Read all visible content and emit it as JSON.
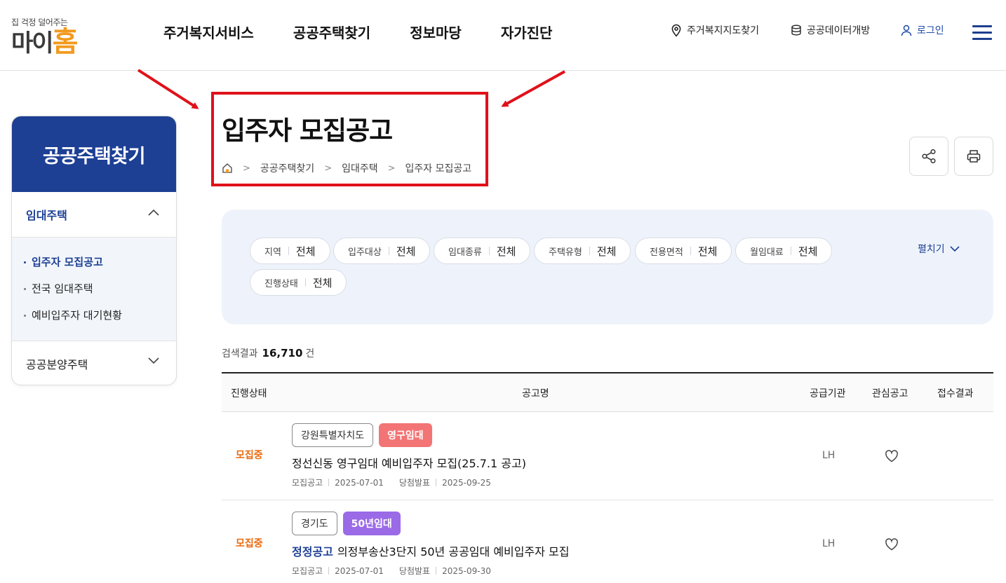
{
  "header": {
    "logo_tagline": "집 걱정 덜어주는",
    "logo_main_a": "마이",
    "logo_main_b": "홈",
    "gnb": [
      "주거복지서비스",
      "공공주택찾기",
      "정보마당",
      "자가진단"
    ],
    "util_map": "주거복지지도찾기",
    "util_data": "공공데이터개방",
    "util_login": "로그인"
  },
  "sidebar": {
    "title": "공공주택찾기",
    "group1": "임대주택",
    "sub_items": [
      "입주자 모집공고",
      "전국 임대주택",
      "예비입주자 대기현황"
    ],
    "group2": "공공분양주택"
  },
  "page": {
    "title": "입주자 모집공고",
    "breadcrumb": [
      "공공주택찾기",
      "임대주택",
      "입주자 모집공고"
    ]
  },
  "filters": {
    "chips": [
      {
        "key": "지역",
        "value": "전체"
      },
      {
        "key": "입주대상",
        "value": "전체"
      },
      {
        "key": "임대종류",
        "value": "전체"
      },
      {
        "key": "주택유형",
        "value": "전체"
      },
      {
        "key": "전용면적",
        "value": "전체"
      },
      {
        "key": "월임대료",
        "value": "전체"
      },
      {
        "key": "진행상태",
        "value": "전체"
      }
    ],
    "expand_label": "펼치기"
  },
  "result": {
    "label": "검색결과",
    "count": "16,710",
    "unit": "건"
  },
  "table": {
    "headers": [
      "진행상태",
      "공고명",
      "공급기관",
      "관심공고",
      "접수결과"
    ],
    "rows": [
      {
        "status": "모집중",
        "region": "강원특별자치도",
        "type": "영구임대",
        "type_color": "#f27474",
        "prefix": "",
        "title": "정선신동 영구임대 예비입주자 모집(25.7.1 공고)",
        "post_label": "모집공고",
        "post_date": "2025-07-01",
        "result_label": "당첨발표",
        "result_date": "2025-09-25",
        "agency": "LH"
      },
      {
        "status": "모집중",
        "region": "경기도",
        "type": "50년임대",
        "type_color": "#9b6ae6",
        "prefix": "정정공고",
        "title": "의정부송산3단지 50년 공공임대 예비입주자 모집",
        "post_label": "모집공고",
        "post_date": "2025-07-01",
        "result_label": "당첨발표",
        "result_date": "2025-09-30",
        "agency": "LH"
      }
    ]
  },
  "colors": {
    "brand_blue": "#1d3f94",
    "accent_orange": "#f29a1f",
    "status_orange": "#ea6a0d",
    "highlight_red": "#e0111a"
  }
}
